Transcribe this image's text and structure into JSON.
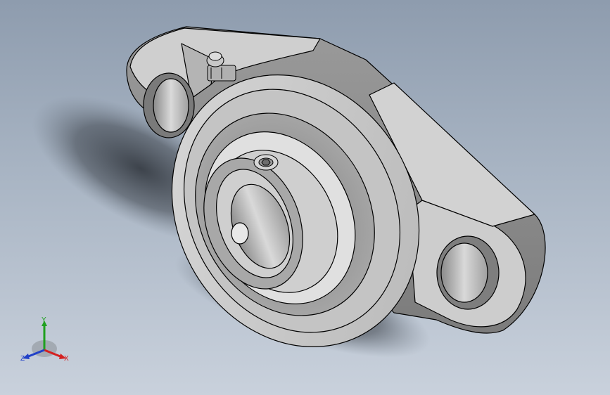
{
  "viewport": {
    "background_top": "#8e9cae",
    "background_bottom": "#c9d1dc"
  },
  "model": {
    "part": "flange-bearing-unit",
    "body_color": "#c9c9c9",
    "edge_color": "#000000"
  },
  "triad": {
    "y_label": "Y",
    "x_label": "X",
    "z_label": "Z",
    "y_color": "#1fa01f",
    "x_color": "#d42020",
    "z_color": "#2040c8"
  }
}
